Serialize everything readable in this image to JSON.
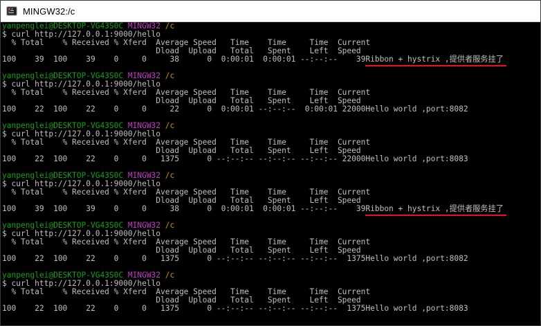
{
  "window": {
    "title": "MINGW32:/c",
    "icon": "git-bash-icon",
    "accent_color": "#e81123"
  },
  "terminal": {
    "colors": {
      "user": "#13a10e",
      "system": "#c837c8",
      "path": "#c19c00",
      "text": "#c0c0c0",
      "highlight": "#e81123"
    },
    "blocks": [
      {
        "user": "yanpenglei@DESKTOP-VG43S0C",
        "system": "MINGW32",
        "path": "/c",
        "command": "$ curl http://127.0.0.1:9000/hello",
        "header1": "  % Total    % Received % Xferd  Average Speed   Time    Time     Time  Current",
        "header2": "                                 Dload  Upload   Total   Spent    Left  Speed",
        "stats": "100    39  100    39    0     0     38      0  0:00:01  0:00:01 --:--:--    39",
        "response": "Ribbon + hystrix ,提供者服务挂了",
        "highlighted": true
      },
      {
        "user": "yanpenglei@DESKTOP-VG43S0C",
        "system": "MINGW32",
        "path": "/c",
        "command": "$ curl http://127.0.0.1:9000/hello",
        "header1": "  % Total    % Received % Xferd  Average Speed   Time    Time     Time  Current",
        "header2": "                                 Dload  Upload   Total   Spent    Left  Speed",
        "stats": "100    22  100    22    0     0     22      0  0:00:01 --:--:--  0:00:01 22000",
        "response": "Hello world ,port:8082",
        "highlighted": false
      },
      {
        "user": "yanpenglei@DESKTOP-VG43S0C",
        "system": "MINGW32",
        "path": "/c",
        "command": "$ curl http://127.0.0.1:9000/hello",
        "header1": "  % Total    % Received % Xferd  Average Speed   Time    Time     Time  Current",
        "header2": "                                 Dload  Upload   Total   Spent    Left  Speed",
        "stats": "100    22  100    22    0     0   1375      0 --:--:-- --:--:-- --:--:-- 22000",
        "response": "Hello world ,port:8083",
        "highlighted": false
      },
      {
        "user": "yanpenglei@DESKTOP-VG43S0C",
        "system": "MINGW32",
        "path": "/c",
        "command": "$ curl http://127.0.0.1:9000/hello",
        "header1": "  % Total    % Received % Xferd  Average Speed   Time    Time     Time  Current",
        "header2": "                                 Dload  Upload   Total   Spent    Left  Speed",
        "stats": "100    39  100    39    0     0     38      0  0:00:01  0:00:01 --:--:--    39",
        "response": "Ribbon + hystrix ,提供者服务挂了",
        "highlighted": true
      },
      {
        "user": "yanpenglei@DESKTOP-VG43S0C",
        "system": "MINGW32",
        "path": "/c",
        "command": "$ curl http://127.0.0.1:9000/hello",
        "header1": "  % Total    % Received % Xferd  Average Speed   Time    Time     Time  Current",
        "header2": "                                 Dload  Upload   Total   Spent    Left  Speed",
        "stats": "100    22  100    22    0     0   1375      0 --:--:-- --:--:-- --:--:--  1375",
        "response": "Hello world ,port:8082",
        "highlighted": false
      },
      {
        "user": "yanpenglei@DESKTOP-VG43S0C",
        "system": "MINGW32",
        "path": "/c",
        "command": "$ curl http://127.0.0.1:9000/hello",
        "header1": "  % Total    % Received % Xferd  Average Speed   Time    Time     Time  Current",
        "header2": "                                 Dload  Upload   Total   Spent    Left  Speed",
        "stats": "100    22  100    22    0     0   1375      0 --:--:-- --:--:-- --:--:--  1375",
        "response": "Hello world ,port:8083",
        "highlighted": false
      }
    ]
  }
}
